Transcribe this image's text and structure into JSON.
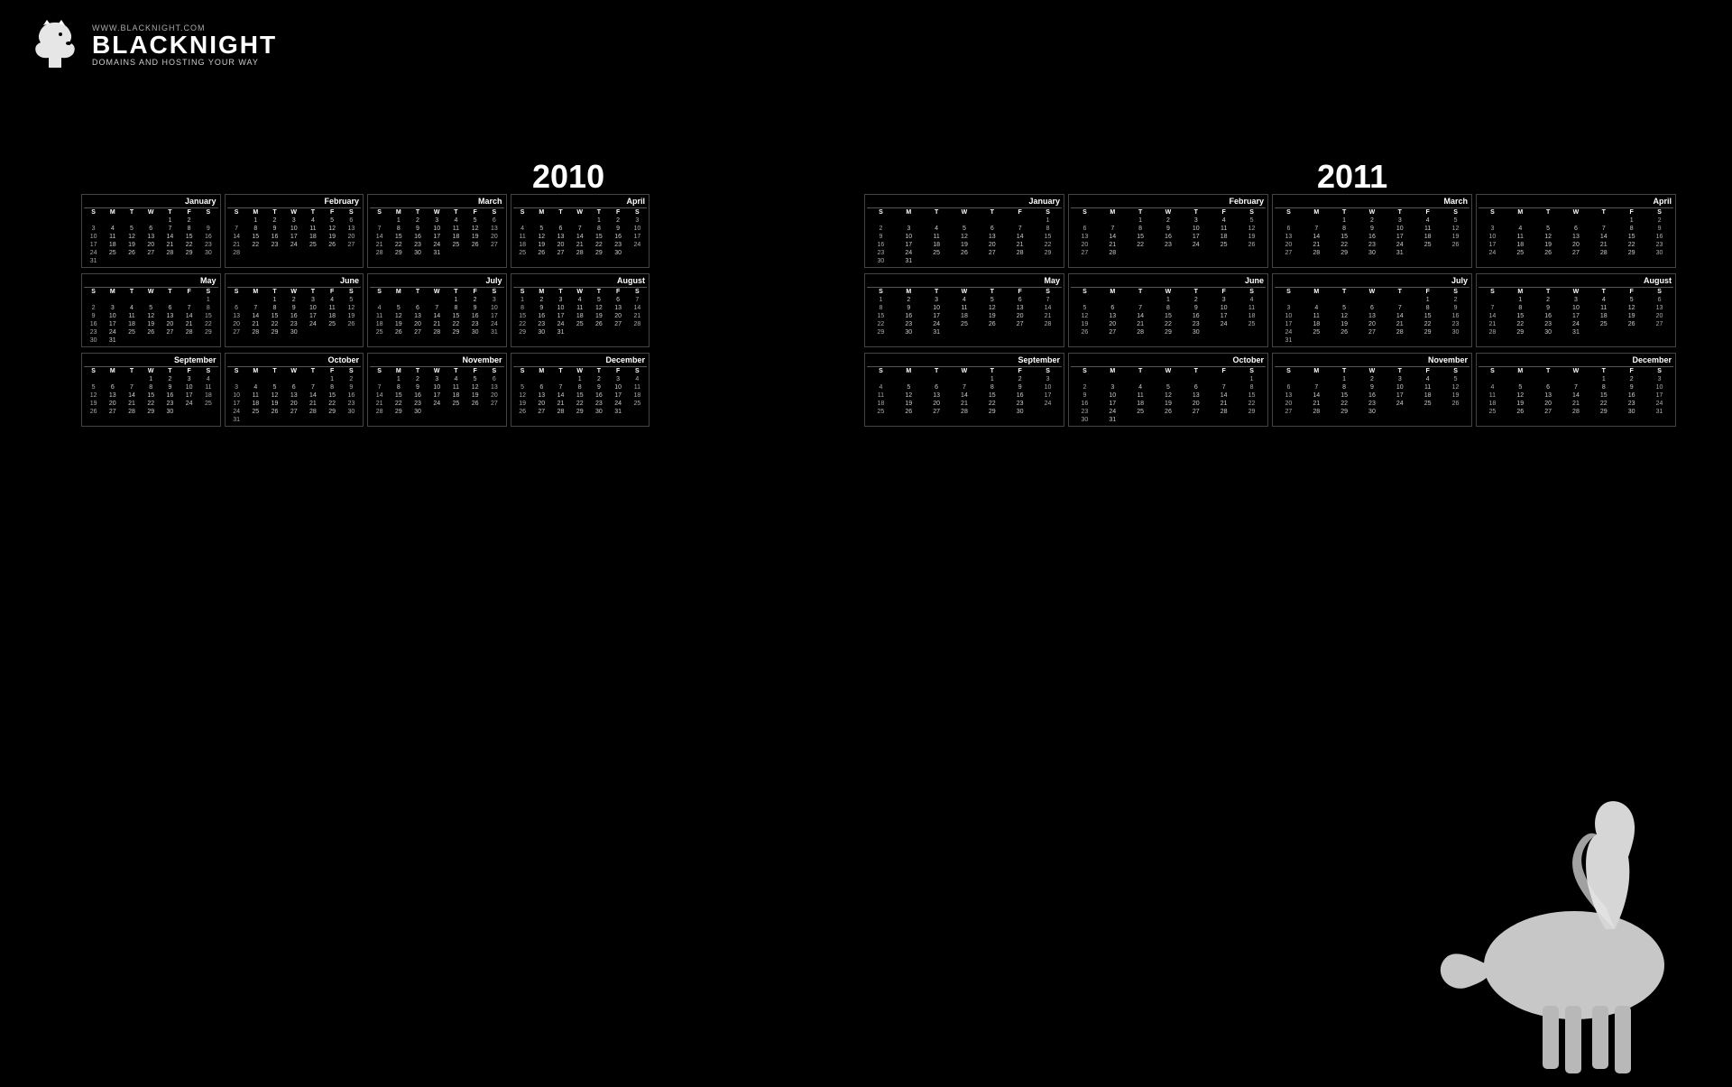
{
  "header": {
    "url": "WWW.BLACKNIGHT.COM",
    "brand": "BLACKNIGHT",
    "tagline": "DOMAINS AND HOSTING YOUR WAY"
  },
  "years": {
    "y2010": "2010",
    "y2011": "2011"
  },
  "cal2010": [
    {
      "name": "January",
      "days": [
        "",
        "",
        "",
        "",
        "1",
        "2"
      ],
      "weeks": [
        [
          "3",
          "4",
          "5",
          "6",
          "7",
          "8",
          "9"
        ],
        [
          "10",
          "11",
          "12",
          "13",
          "14",
          "15",
          "16"
        ],
        [
          "17",
          "18",
          "19",
          "20",
          "21",
          "22",
          "23"
        ],
        [
          "24",
          "25",
          "26",
          "27",
          "28",
          "29",
          "30"
        ],
        [
          "31",
          "",
          "",
          "",
          "",
          "",
          ""
        ]
      ]
    },
    {
      "name": "February",
      "days": [
        "",
        "1",
        "2",
        "3",
        "4",
        "5",
        "6"
      ],
      "weeks": [
        [
          "7",
          "8",
          "9",
          "10",
          "11",
          "12",
          "13"
        ],
        [
          "14",
          "15",
          "16",
          "17",
          "18",
          "19",
          "20"
        ],
        [
          "21",
          "22",
          "23",
          "24",
          "25",
          "26",
          "27"
        ],
        [
          "28",
          "",
          "",
          "",
          "",
          "",
          ""
        ]
      ]
    },
    {
      "name": "March",
      "days": [
        "",
        "1",
        "2",
        "3",
        "4",
        "5",
        "6"
      ],
      "weeks": [
        [
          "7",
          "8",
          "9",
          "10",
          "11",
          "12",
          "13"
        ],
        [
          "14",
          "15",
          "16",
          "17",
          "18",
          "19",
          "20"
        ],
        [
          "21",
          "22",
          "23",
          "24",
          "25",
          "26",
          "27"
        ],
        [
          "28",
          "29",
          "30",
          "31",
          "",
          "",
          ""
        ]
      ]
    },
    {
      "name": "April",
      "days": [
        "",
        "",
        "",
        "",
        "1",
        "2",
        "3"
      ],
      "weeks": [
        [
          "4",
          "5",
          "6",
          "7",
          "8",
          "9",
          "10"
        ],
        [
          "11",
          "12",
          "13",
          "14",
          "15",
          "16",
          "17"
        ],
        [
          "18",
          "19",
          "20",
          "21",
          "22",
          "23",
          "24"
        ],
        [
          "25",
          "26",
          "27",
          "28",
          "29",
          "30",
          ""
        ]
      ]
    },
    {
      "name": "May",
      "days": [
        "",
        "",
        "",
        "",
        "",
        "",
        "1"
      ],
      "weeks": [
        [
          "2",
          "3",
          "4",
          "5",
          "6",
          "7",
          "8"
        ],
        [
          "9",
          "10",
          "11",
          "12",
          "13",
          "14",
          "15"
        ],
        [
          "16",
          "17",
          "18",
          "19",
          "20",
          "21",
          "22"
        ],
        [
          "23",
          "24",
          "25",
          "26",
          "27",
          "28",
          "29"
        ],
        [
          "30",
          "31",
          "",
          "",
          "",
          "",
          ""
        ]
      ]
    },
    {
      "name": "June",
      "days": [
        "",
        "",
        "1",
        "2",
        "3",
        "4",
        "5"
      ],
      "weeks": [
        [
          "6",
          "7",
          "8",
          "9",
          "10",
          "11",
          "12"
        ],
        [
          "13",
          "14",
          "15",
          "16",
          "17",
          "18",
          "19"
        ],
        [
          "20",
          "21",
          "22",
          "23",
          "24",
          "25",
          "26"
        ],
        [
          "27",
          "28",
          "29",
          "30",
          "",
          "",
          ""
        ]
      ]
    },
    {
      "name": "July",
      "days": [
        "",
        "",
        "",
        "",
        "1",
        "2",
        "3"
      ],
      "weeks": [
        [
          "4",
          "5",
          "6",
          "7",
          "8",
          "9",
          "10"
        ],
        [
          "11",
          "12",
          "13",
          "14",
          "15",
          "16",
          "17"
        ],
        [
          "18",
          "19",
          "20",
          "21",
          "22",
          "23",
          "24"
        ],
        [
          "25",
          "26",
          "27",
          "28",
          "29",
          "30",
          "31"
        ]
      ]
    },
    {
      "name": "August",
      "days": [
        "1",
        "2",
        "3",
        "4",
        "5",
        "6",
        "7"
      ],
      "weeks": [
        [
          "8",
          "9",
          "10",
          "11",
          "12",
          "13",
          "14"
        ],
        [
          "15",
          "16",
          "17",
          "18",
          "19",
          "20",
          "21"
        ],
        [
          "22",
          "23",
          "24",
          "25",
          "26",
          "27",
          "28"
        ],
        [
          "29",
          "30",
          "31",
          "",
          "",
          "",
          ""
        ]
      ]
    },
    {
      "name": "September",
      "days": [
        "",
        "",
        "",
        "1",
        "2",
        "3",
        "4"
      ],
      "weeks": [
        [
          "5",
          "6",
          "7",
          "8",
          "9",
          "10",
          "11"
        ],
        [
          "12",
          "13",
          "14",
          "15",
          "16",
          "17",
          "18"
        ],
        [
          "19",
          "20",
          "21",
          "22",
          "23",
          "24",
          "25"
        ],
        [
          "26",
          "27",
          "28",
          "29",
          "30",
          "",
          ""
        ]
      ]
    },
    {
      "name": "October",
      "days": [
        "",
        "",
        "",
        "",
        "",
        "1",
        "2"
      ],
      "weeks": [
        [
          "3",
          "4",
          "5",
          "6",
          "7",
          "8",
          "9"
        ],
        [
          "10",
          "11",
          "12",
          "13",
          "14",
          "15",
          "16"
        ],
        [
          "17",
          "18",
          "19",
          "20",
          "21",
          "22",
          "23"
        ],
        [
          "24",
          "25",
          "26",
          "27",
          "28",
          "29",
          "30"
        ],
        [
          "31",
          "",
          "",
          "",
          "",
          "",
          ""
        ]
      ]
    },
    {
      "name": "November",
      "days": [
        "",
        "1",
        "2",
        "3",
        "4",
        "5",
        "6"
      ],
      "weeks": [
        [
          "7",
          "8",
          "9",
          "10",
          "11",
          "12",
          "13"
        ],
        [
          "14",
          "15",
          "16",
          "17",
          "18",
          "19",
          "20"
        ],
        [
          "21",
          "22",
          "23",
          "24",
          "25",
          "26",
          "27"
        ],
        [
          "28",
          "29",
          "30",
          "",
          "",
          "",
          ""
        ]
      ]
    },
    {
      "name": "December",
      "days": [
        "",
        "",
        "",
        "1",
        "2",
        "3",
        "4"
      ],
      "weeks": [
        [
          "5",
          "6",
          "7",
          "8",
          "9",
          "10",
          "11"
        ],
        [
          "12",
          "13",
          "14",
          "15",
          "16",
          "17",
          "18"
        ],
        [
          "19",
          "20",
          "21",
          "22",
          "23",
          "24",
          "25"
        ],
        [
          "26",
          "27",
          "28",
          "29",
          "30",
          "31",
          ""
        ]
      ]
    }
  ],
  "cal2011": [
    {
      "name": "January",
      "days": [
        "",
        "",
        "",
        "",
        "",
        "",
        "1"
      ],
      "weeks": [
        [
          "2",
          "3",
          "4",
          "5",
          "6",
          "7",
          "8"
        ],
        [
          "9",
          "10",
          "11",
          "12",
          "13",
          "14",
          "15"
        ],
        [
          "16",
          "17",
          "18",
          "19",
          "20",
          "21",
          "22"
        ],
        [
          "23",
          "24",
          "25",
          "26",
          "27",
          "28",
          "29"
        ],
        [
          "30",
          "31",
          "",
          "",
          "",
          "",
          ""
        ]
      ]
    },
    {
      "name": "February",
      "days": [
        "",
        "",
        "1",
        "2",
        "3",
        "4",
        "5"
      ],
      "weeks": [
        [
          "6",
          "7",
          "8",
          "9",
          "10",
          "11",
          "12"
        ],
        [
          "13",
          "14",
          "15",
          "16",
          "17",
          "18",
          "19"
        ],
        [
          "20",
          "21",
          "22",
          "23",
          "24",
          "25",
          "26"
        ],
        [
          "27",
          "28",
          "",
          "",
          "",
          "",
          ""
        ]
      ]
    },
    {
      "name": "March",
      "days": [
        "",
        "",
        "1",
        "2",
        "3",
        "4",
        "5"
      ],
      "weeks": [
        [
          "6",
          "7",
          "8",
          "9",
          "10",
          "11",
          "12"
        ],
        [
          "13",
          "14",
          "15",
          "16",
          "17",
          "18",
          "19"
        ],
        [
          "20",
          "21",
          "22",
          "23",
          "24",
          "25",
          "26"
        ],
        [
          "27",
          "28",
          "29",
          "30",
          "31",
          "",
          ""
        ]
      ]
    },
    {
      "name": "April",
      "days": [
        "",
        "",
        "",
        "",
        "",
        "1",
        "2"
      ],
      "weeks": [
        [
          "3",
          "4",
          "5",
          "6",
          "7",
          "8",
          "9"
        ],
        [
          "10",
          "11",
          "12",
          "13",
          "14",
          "15",
          "16"
        ],
        [
          "17",
          "18",
          "19",
          "20",
          "21",
          "22",
          "23"
        ],
        [
          "24",
          "25",
          "26",
          "27",
          "28",
          "29",
          "30"
        ]
      ]
    },
    {
      "name": "May",
      "days": [
        "1",
        "2",
        "3",
        "4",
        "5",
        "6",
        "7"
      ],
      "weeks": [
        [
          "8",
          "9",
          "10",
          "11",
          "12",
          "13",
          "14"
        ],
        [
          "15",
          "16",
          "17",
          "18",
          "19",
          "20",
          "21"
        ],
        [
          "22",
          "23",
          "24",
          "25",
          "26",
          "27",
          "28"
        ],
        [
          "29",
          "30",
          "31",
          "",
          "",
          "",
          ""
        ]
      ]
    },
    {
      "name": "June",
      "days": [
        "",
        "",
        "",
        "1",
        "2",
        "3",
        "4"
      ],
      "weeks": [
        [
          "5",
          "6",
          "7",
          "8",
          "9",
          "10",
          "11"
        ],
        [
          "12",
          "13",
          "14",
          "15",
          "16",
          "17",
          "18"
        ],
        [
          "19",
          "20",
          "21",
          "22",
          "23",
          "24",
          "25"
        ],
        [
          "26",
          "27",
          "28",
          "29",
          "30",
          "",
          ""
        ]
      ]
    },
    {
      "name": "July",
      "days": [
        "",
        "",
        "",
        "",
        "",
        "1",
        "2"
      ],
      "weeks": [
        [
          "3",
          "4",
          "5",
          "6",
          "7",
          "8",
          "9"
        ],
        [
          "10",
          "11",
          "12",
          "13",
          "14",
          "15",
          "16"
        ],
        [
          "17",
          "18",
          "19",
          "20",
          "21",
          "22",
          "23"
        ],
        [
          "24",
          "25",
          "26",
          "27",
          "28",
          "29",
          "30"
        ],
        [
          "31",
          "",
          "",
          "",
          "",
          "",
          ""
        ]
      ]
    },
    {
      "name": "August",
      "days": [
        "",
        "1",
        "2",
        "3",
        "4",
        "5",
        "6"
      ],
      "weeks": [
        [
          "7",
          "8",
          "9",
          "10",
          "11",
          "12",
          "13"
        ],
        [
          "14",
          "15",
          "16",
          "17",
          "18",
          "19",
          "20"
        ],
        [
          "21",
          "22",
          "23",
          "24",
          "25",
          "26",
          "27"
        ],
        [
          "28",
          "29",
          "30",
          "31",
          "",
          "",
          ""
        ]
      ]
    },
    {
      "name": "September",
      "days": [
        "",
        "",
        "",
        "",
        "1",
        "2",
        "3"
      ],
      "weeks": [
        [
          "4",
          "5",
          "6",
          "7",
          "8",
          "9",
          "10"
        ],
        [
          "11",
          "12",
          "13",
          "14",
          "15",
          "16",
          "17"
        ],
        [
          "18",
          "19",
          "20",
          "21",
          "22",
          "23",
          "24"
        ],
        [
          "25",
          "26",
          "27",
          "28",
          "29",
          "30",
          ""
        ]
      ]
    },
    {
      "name": "October",
      "days": [
        "",
        "",
        "",
        "",
        "",
        "",
        "1"
      ],
      "weeks": [
        [
          "2",
          "3",
          "4",
          "5",
          "6",
          "7",
          "8"
        ],
        [
          "9",
          "10",
          "11",
          "12",
          "13",
          "14",
          "15"
        ],
        [
          "16",
          "17",
          "18",
          "19",
          "20",
          "21",
          "22"
        ],
        [
          "23",
          "24",
          "25",
          "26",
          "27",
          "28",
          "29"
        ],
        [
          "30",
          "31",
          "",
          "",
          "",
          "",
          ""
        ]
      ]
    },
    {
      "name": "November",
      "days": [
        "",
        "",
        "1",
        "2",
        "3",
        "4",
        "5"
      ],
      "weeks": [
        [
          "6",
          "7",
          "8",
          "9",
          "10",
          "11",
          "12"
        ],
        [
          "13",
          "14",
          "15",
          "16",
          "17",
          "18",
          "19"
        ],
        [
          "20",
          "21",
          "22",
          "23",
          "24",
          "25",
          "26"
        ],
        [
          "27",
          "28",
          "29",
          "30",
          "",
          "",
          ""
        ]
      ]
    },
    {
      "name": "December",
      "days": [
        "",
        "",
        "",
        "",
        "1",
        "2",
        "3"
      ],
      "weeks": [
        [
          "4",
          "5",
          "6",
          "7",
          "8",
          "9",
          "10"
        ],
        [
          "11",
          "12",
          "13",
          "14",
          "15",
          "16",
          "17"
        ],
        [
          "18",
          "19",
          "20",
          "21",
          "22",
          "23",
          "24"
        ],
        [
          "25",
          "26",
          "27",
          "28",
          "29",
          "30",
          "31"
        ]
      ]
    }
  ]
}
